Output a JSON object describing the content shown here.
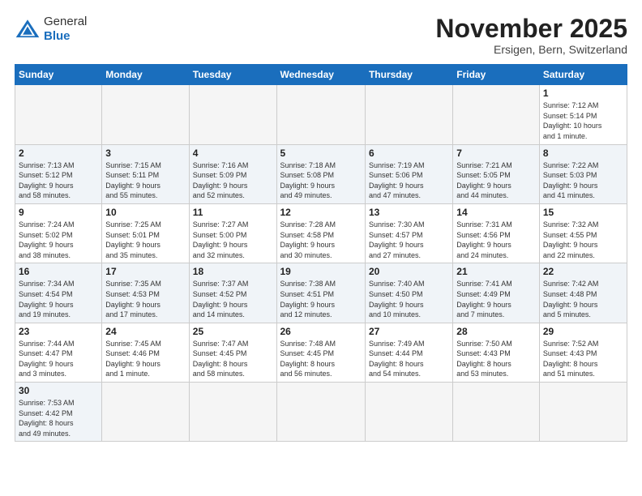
{
  "logo": {
    "general": "General",
    "blue": "Blue"
  },
  "header": {
    "month_title": "November 2025",
    "subtitle": "Ersigen, Bern, Switzerland"
  },
  "weekdays": [
    "Sunday",
    "Monday",
    "Tuesday",
    "Wednesday",
    "Thursday",
    "Friday",
    "Saturday"
  ],
  "weeks": [
    [
      {
        "day": "",
        "info": ""
      },
      {
        "day": "",
        "info": ""
      },
      {
        "day": "",
        "info": ""
      },
      {
        "day": "",
        "info": ""
      },
      {
        "day": "",
        "info": ""
      },
      {
        "day": "",
        "info": ""
      },
      {
        "day": "1",
        "info": "Sunrise: 7:12 AM\nSunset: 5:14 PM\nDaylight: 10 hours\nand 1 minute."
      }
    ],
    [
      {
        "day": "2",
        "info": "Sunrise: 7:13 AM\nSunset: 5:12 PM\nDaylight: 9 hours\nand 58 minutes."
      },
      {
        "day": "3",
        "info": "Sunrise: 7:15 AM\nSunset: 5:11 PM\nDaylight: 9 hours\nand 55 minutes."
      },
      {
        "day": "4",
        "info": "Sunrise: 7:16 AM\nSunset: 5:09 PM\nDaylight: 9 hours\nand 52 minutes."
      },
      {
        "day": "5",
        "info": "Sunrise: 7:18 AM\nSunset: 5:08 PM\nDaylight: 9 hours\nand 49 minutes."
      },
      {
        "day": "6",
        "info": "Sunrise: 7:19 AM\nSunset: 5:06 PM\nDaylight: 9 hours\nand 47 minutes."
      },
      {
        "day": "7",
        "info": "Sunrise: 7:21 AM\nSunset: 5:05 PM\nDaylight: 9 hours\nand 44 minutes."
      },
      {
        "day": "8",
        "info": "Sunrise: 7:22 AM\nSunset: 5:03 PM\nDaylight: 9 hours\nand 41 minutes."
      }
    ],
    [
      {
        "day": "9",
        "info": "Sunrise: 7:24 AM\nSunset: 5:02 PM\nDaylight: 9 hours\nand 38 minutes."
      },
      {
        "day": "10",
        "info": "Sunrise: 7:25 AM\nSunset: 5:01 PM\nDaylight: 9 hours\nand 35 minutes."
      },
      {
        "day": "11",
        "info": "Sunrise: 7:27 AM\nSunset: 5:00 PM\nDaylight: 9 hours\nand 32 minutes."
      },
      {
        "day": "12",
        "info": "Sunrise: 7:28 AM\nSunset: 4:58 PM\nDaylight: 9 hours\nand 30 minutes."
      },
      {
        "day": "13",
        "info": "Sunrise: 7:30 AM\nSunset: 4:57 PM\nDaylight: 9 hours\nand 27 minutes."
      },
      {
        "day": "14",
        "info": "Sunrise: 7:31 AM\nSunset: 4:56 PM\nDaylight: 9 hours\nand 24 minutes."
      },
      {
        "day": "15",
        "info": "Sunrise: 7:32 AM\nSunset: 4:55 PM\nDaylight: 9 hours\nand 22 minutes."
      }
    ],
    [
      {
        "day": "16",
        "info": "Sunrise: 7:34 AM\nSunset: 4:54 PM\nDaylight: 9 hours\nand 19 minutes."
      },
      {
        "day": "17",
        "info": "Sunrise: 7:35 AM\nSunset: 4:53 PM\nDaylight: 9 hours\nand 17 minutes."
      },
      {
        "day": "18",
        "info": "Sunrise: 7:37 AM\nSunset: 4:52 PM\nDaylight: 9 hours\nand 14 minutes."
      },
      {
        "day": "19",
        "info": "Sunrise: 7:38 AM\nSunset: 4:51 PM\nDaylight: 9 hours\nand 12 minutes."
      },
      {
        "day": "20",
        "info": "Sunrise: 7:40 AM\nSunset: 4:50 PM\nDaylight: 9 hours\nand 10 minutes."
      },
      {
        "day": "21",
        "info": "Sunrise: 7:41 AM\nSunset: 4:49 PM\nDaylight: 9 hours\nand 7 minutes."
      },
      {
        "day": "22",
        "info": "Sunrise: 7:42 AM\nSunset: 4:48 PM\nDaylight: 9 hours\nand 5 minutes."
      }
    ],
    [
      {
        "day": "23",
        "info": "Sunrise: 7:44 AM\nSunset: 4:47 PM\nDaylight: 9 hours\nand 3 minutes."
      },
      {
        "day": "24",
        "info": "Sunrise: 7:45 AM\nSunset: 4:46 PM\nDaylight: 9 hours\nand 1 minute."
      },
      {
        "day": "25",
        "info": "Sunrise: 7:47 AM\nSunset: 4:45 PM\nDaylight: 8 hours\nand 58 minutes."
      },
      {
        "day": "26",
        "info": "Sunrise: 7:48 AM\nSunset: 4:45 PM\nDaylight: 8 hours\nand 56 minutes."
      },
      {
        "day": "27",
        "info": "Sunrise: 7:49 AM\nSunset: 4:44 PM\nDaylight: 8 hours\nand 54 minutes."
      },
      {
        "day": "28",
        "info": "Sunrise: 7:50 AM\nSunset: 4:43 PM\nDaylight: 8 hours\nand 53 minutes."
      },
      {
        "day": "29",
        "info": "Sunrise: 7:52 AM\nSunset: 4:43 PM\nDaylight: 8 hours\nand 51 minutes."
      }
    ],
    [
      {
        "day": "30",
        "info": "Sunrise: 7:53 AM\nSunset: 4:42 PM\nDaylight: 8 hours\nand 49 minutes."
      },
      {
        "day": "",
        "info": ""
      },
      {
        "day": "",
        "info": ""
      },
      {
        "day": "",
        "info": ""
      },
      {
        "day": "",
        "info": ""
      },
      {
        "day": "",
        "info": ""
      },
      {
        "day": "",
        "info": ""
      }
    ]
  ]
}
